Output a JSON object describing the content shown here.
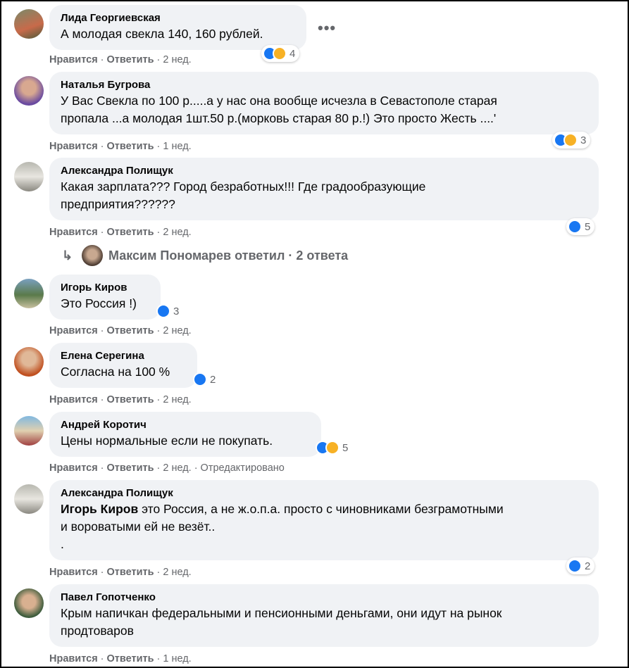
{
  "actions": {
    "like": "Нравится",
    "reply": "Ответить",
    "sep": "·",
    "edited": "Отредактировано"
  },
  "menu": {
    "more_label": "•••"
  },
  "comments": [
    {
      "author": "Лида Георгиевская",
      "text": "А молодая свекла 140, 160 рублей.",
      "time": "2 нед.",
      "reactions": [
        "like",
        "sad"
      ],
      "count": "4"
    },
    {
      "author": "Наталья Бугрова",
      "text_lines": [
        "У Вас Свекла по 100 р.....а у нас она вообще исчезла в Севастополе старая",
        "пропала ...а молодая 1шт.50 р.(морковь старая 80 р.!) Это просто Жесть ....'"
      ],
      "time": "1 нед.",
      "reactions": [
        "like",
        "sad"
      ],
      "count": "3"
    },
    {
      "author": "Александра Полищук",
      "text_lines": [
        "Какая зарплата??? Город безработных!!! Где градообразующие",
        "предприятия??????"
      ],
      "time": "2 нед.",
      "reactions": [
        "like"
      ],
      "count": "5"
    },
    {
      "author": "Игорь Киров",
      "text": "Это Россия !)",
      "time": "2 нед.",
      "reactions": [
        "like"
      ],
      "count": "3"
    },
    {
      "author": "Елена Серегина",
      "text": "Согласна на 100 %",
      "time": "2 нед.",
      "reactions": [
        "like"
      ],
      "count": "2"
    },
    {
      "author": "Андрей Коротич",
      "text": "Цены нормальные если не покупать.",
      "time": "2 нед.",
      "reactions": [
        "like",
        "haha"
      ],
      "count": "5",
      "edited": true
    },
    {
      "author": "Александра Полищук",
      "mention": "Игорь Киров",
      "text_lines": [
        " это Россия, а не ж.о.п.а. просто с чиновниками безграмотными",
        "и вороватыми ей не везёт..",
        "."
      ],
      "time": "2 нед.",
      "reactions": [
        "like"
      ],
      "count": "2"
    },
    {
      "author": "Павел Гопотченко",
      "text_lines": [
        "Крым напичкан федеральными и пенсионными деньгами, они идут на рынок",
        "продтоваров"
      ],
      "time": "1 нед."
    }
  ],
  "reply_thread": {
    "arrow": "↳",
    "label": "Максим Пономарев ответил · 2 ответа"
  },
  "colors": {
    "like_blue": "#1877f2",
    "bubble_bg": "#f0f2f5",
    "meta_gray": "#65676b",
    "emoji_yellow": "#f7b125"
  }
}
